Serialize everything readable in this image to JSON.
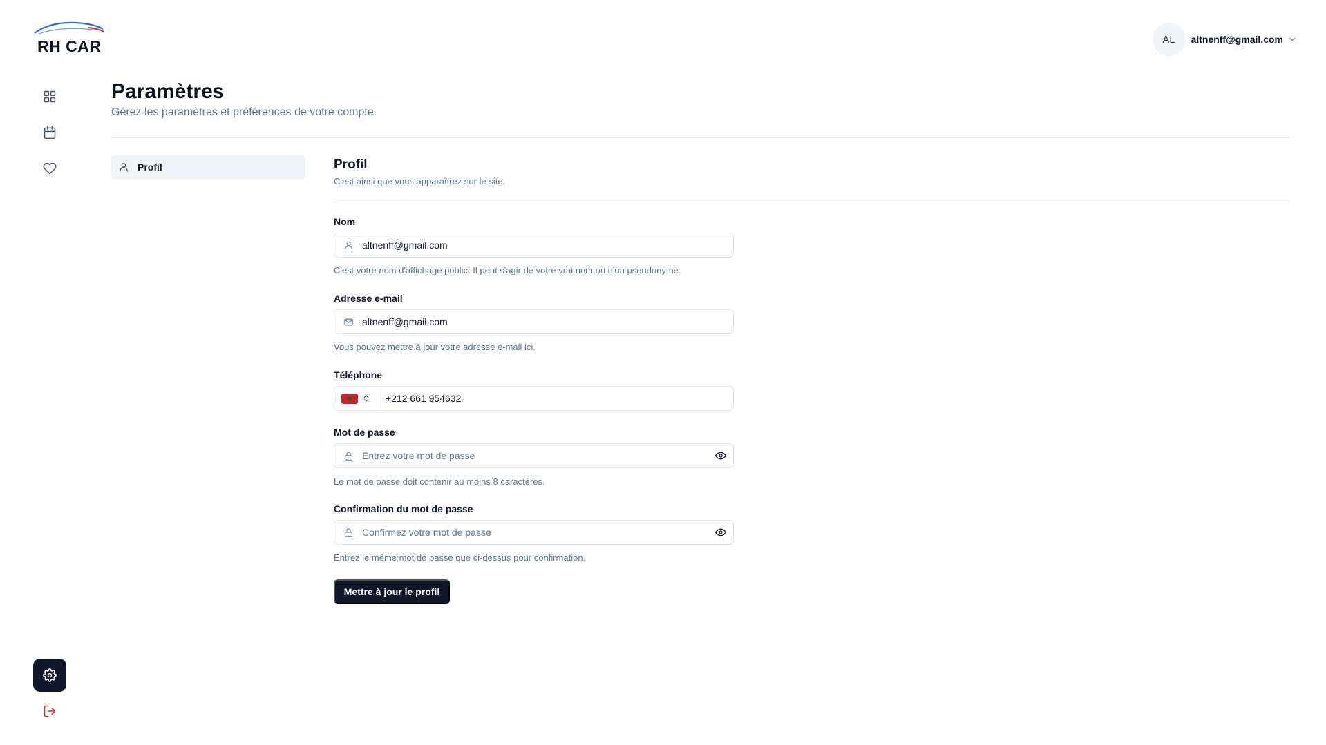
{
  "brand": {
    "name": "RH CAR",
    "logo_icon": "car-silhouette-icon",
    "accent_blue": "#2f6fcf",
    "accent_red": "#d32f2f"
  },
  "sidebar": {
    "items": [
      {
        "name": "dashboard",
        "icon": "grid-icon"
      },
      {
        "name": "calendar",
        "icon": "calendar-icon"
      },
      {
        "name": "favorites",
        "icon": "heart-icon"
      }
    ],
    "bottom": [
      {
        "name": "settings",
        "icon": "gear-icon",
        "active": true
      },
      {
        "name": "logout",
        "icon": "logout-icon",
        "color": "#dc2626"
      }
    ]
  },
  "user": {
    "initials": "AL",
    "email": "altnenff@gmail.com",
    "menu_icon": "chevron-down-icon"
  },
  "header": {
    "title": "Paramètres",
    "subtitle": "Gérez les paramètres et préférences de votre compte."
  },
  "settings_nav": {
    "items": [
      {
        "label": "Profil",
        "icon": "user-icon",
        "active": true
      }
    ]
  },
  "profile": {
    "title": "Profil",
    "description": "C'est ainsi que vous apparaîtrez sur le site.",
    "fields": {
      "name": {
        "label": "Nom",
        "value": "altnenff@gmail.com",
        "hint": "C'est votre nom d'affichage public. Il peut s'agir de votre vrai nom ou d'un pseudonyme.",
        "icon": "user-icon"
      },
      "email": {
        "label": "Adresse e-mail",
        "value": "altnenff@gmail.com",
        "hint": "Vous pouvez mettre à jour votre adresse e-mail ici.",
        "icon": "mail-icon"
      },
      "phone": {
        "label": "Téléphone",
        "value": "+212 661 954632",
        "country_flag": "morocco-flag-icon",
        "flag_color": "#c1272d"
      },
      "password": {
        "label": "Mot de passe",
        "placeholder": "Entrez votre mot de passe",
        "hint": "Le mot de passe doit contenir au moins 8 caractères.",
        "icon": "lock-icon"
      },
      "password_confirm": {
        "label": "Confirmation du mot de passe",
        "placeholder": "Confirmez votre mot de passe",
        "hint": "Entrez le même mot de passe que ci-dessus pour confirmation.",
        "icon": "lock-icon"
      }
    },
    "submit_label": "Mettre à jour le profil",
    "primary_color": "#0f172a"
  }
}
